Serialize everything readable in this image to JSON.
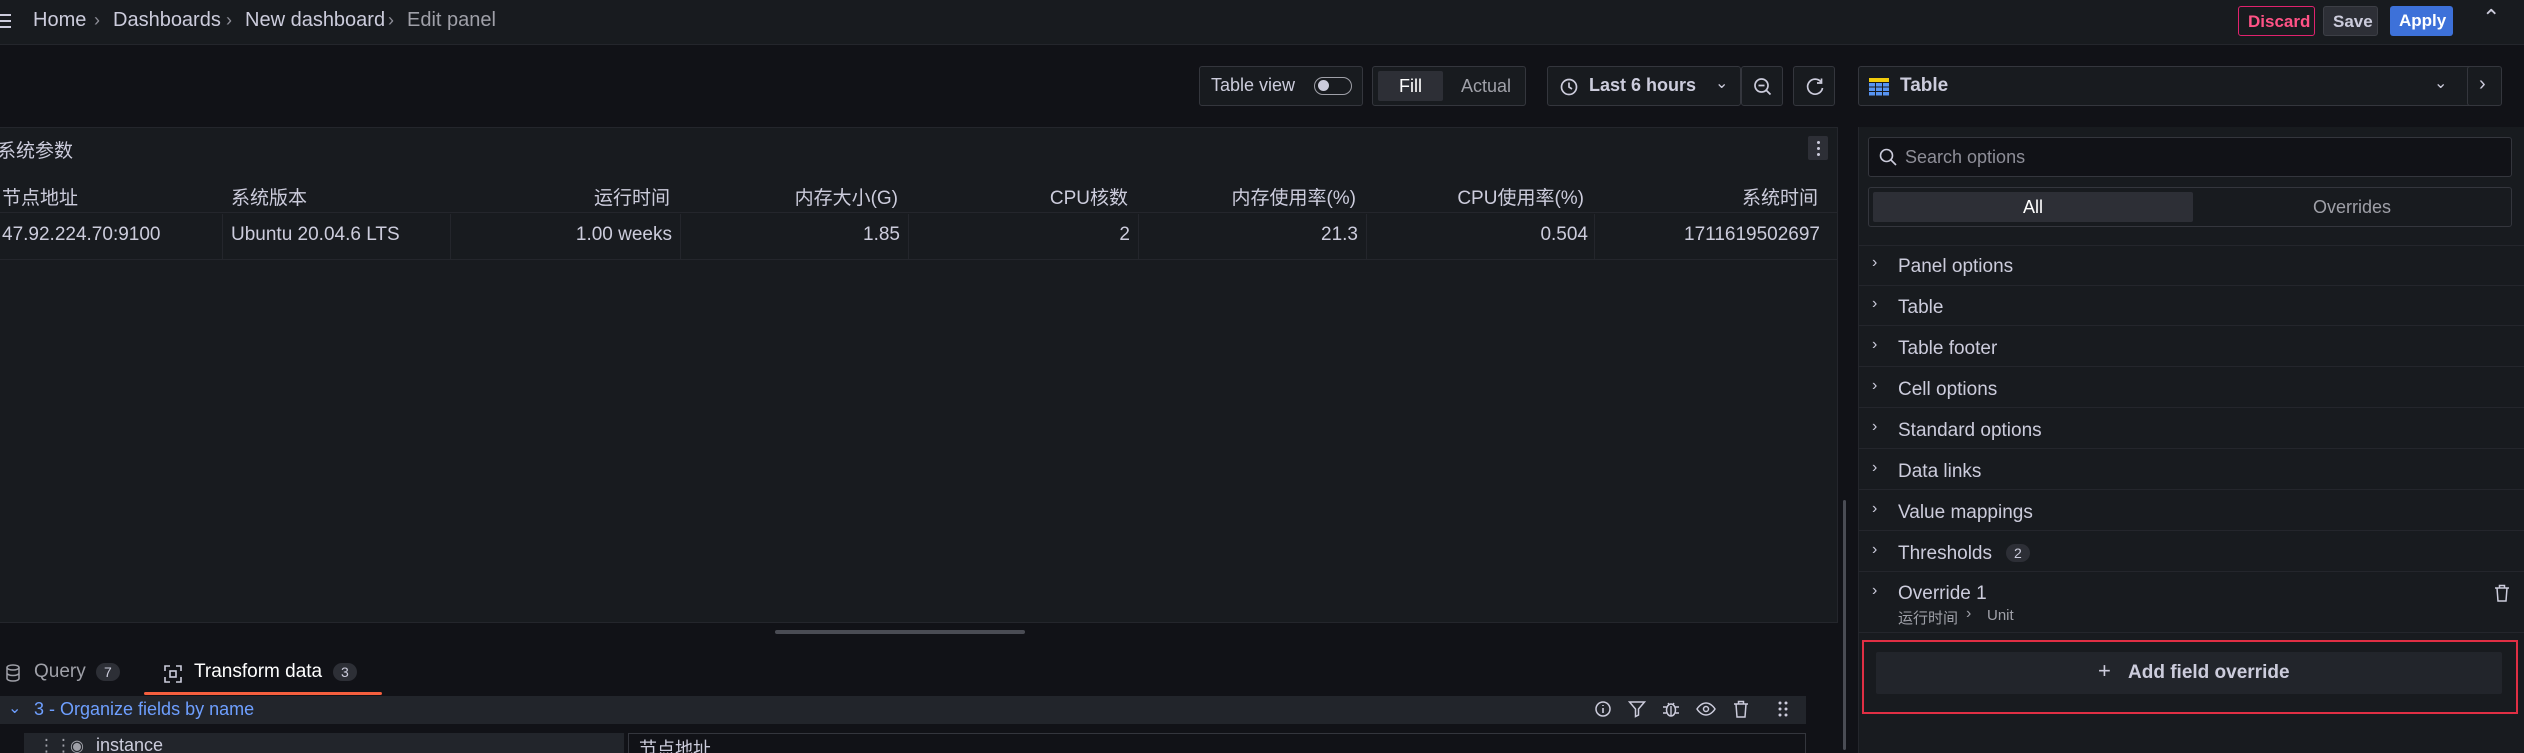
{
  "header": {
    "breadcrumb": [
      "Home",
      "Dashboards",
      "New dashboard",
      "Edit panel"
    ],
    "discard_label": "Discard",
    "save_label": "Save",
    "apply_label": "Apply"
  },
  "toolbar": {
    "table_view_label": "Table view",
    "fill_label": "Fill",
    "actual_label": "Actual",
    "time_range": "Last 6 hours",
    "visualization": "Table"
  },
  "panel": {
    "title": "系统参数",
    "columns": [
      "节点地址",
      "系统版本",
      "运行时间",
      "内存大小(G)",
      "CPU核数",
      "内存使用率(%)",
      "CPU使用率(%)",
      "系统时间"
    ],
    "rows": [
      [
        "47.92.224.70:9100",
        "Ubuntu 20.04.6 LTS",
        "1.00 weeks",
        "1.85",
        "2",
        "21.3",
        "0.504",
        "1711619502697"
      ]
    ]
  },
  "bottom": {
    "tabs": [
      {
        "label": "Query",
        "count": "7"
      },
      {
        "label": "Transform data",
        "count": "3"
      }
    ],
    "transform_title": "3 - Organize fields by name",
    "field_name": "instance",
    "field_rename": "节点地址"
  },
  "options": {
    "search_placeholder": "Search options",
    "tabs": [
      "All",
      "Overrides"
    ],
    "sections": [
      {
        "label": "Panel options"
      },
      {
        "label": "Table"
      },
      {
        "label": "Table footer"
      },
      {
        "label": "Cell options"
      },
      {
        "label": "Standard options"
      },
      {
        "label": "Data links"
      },
      {
        "label": "Value mappings"
      },
      {
        "label": "Thresholds",
        "count": "2"
      }
    ],
    "override": {
      "title": "Override 1",
      "path_field": "运行时间",
      "path_prop": "Unit"
    },
    "add_override_label": "Add field override"
  },
  "colors": {
    "discard": "#ff5286",
    "apply": "#3d71d9",
    "accent": "#6e9fff",
    "active_tab_underline": "#f55f3e",
    "highlight_box": "#e02f44"
  }
}
